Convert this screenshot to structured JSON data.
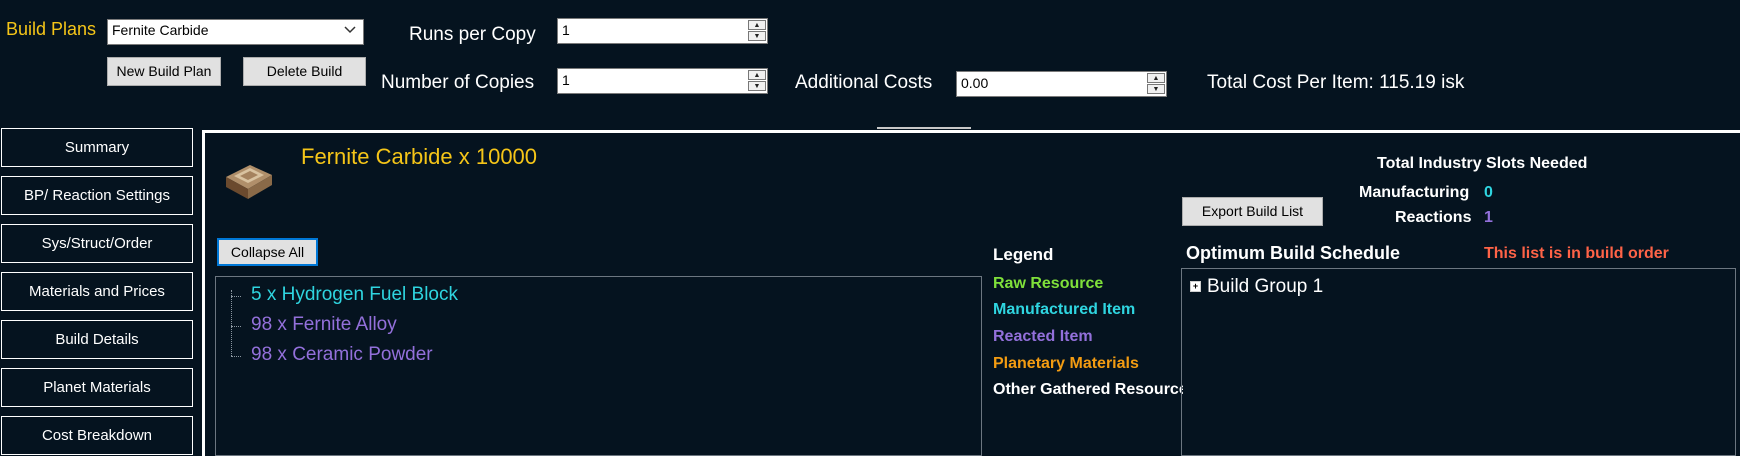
{
  "toolbar": {
    "build_plans_label": "Build Plans",
    "build_plan_value": "Fernite Carbide",
    "new_build_plan": "New Build Plan",
    "delete_build": "Delete Build",
    "runs_per_copy_label": "Runs per Copy",
    "runs_per_copy_value": "1",
    "number_of_copies_label": "Number of Copies",
    "number_of_copies_value": "1",
    "additional_costs_label": "Additional Costs",
    "additional_costs_value": "0.00",
    "total_cost": "Total Cost Per Item: 115.19 isk"
  },
  "nav": {
    "items": [
      {
        "label": "Summary"
      },
      {
        "label": "BP/ Reaction Settings"
      },
      {
        "label": "Sys/Struct/Order"
      },
      {
        "label": "Materials and Prices"
      },
      {
        "label": "Build Details"
      },
      {
        "label": "Planet Materials"
      },
      {
        "label": "Cost Breakdown"
      }
    ]
  },
  "main": {
    "product_title": "Fernite Carbide x 10000",
    "collapse_all": "Collapse All",
    "tree": [
      {
        "label": "5 x Hydrogen Fuel Block",
        "color": "#2fd5e0"
      },
      {
        "label": "98 x Fernite Alloy",
        "color": "#9370db"
      },
      {
        "label": "98 x Ceramic Powder",
        "color": "#9370db"
      }
    ],
    "legend": {
      "title": "Legend",
      "items": [
        {
          "label": "Raw Resource",
          "color": "#7fe03a"
        },
        {
          "label": "Manufactured Item",
          "color": "#2fd5e0"
        },
        {
          "label": "Reacted Item",
          "color": "#9370db"
        },
        {
          "label": "Planetary Materials",
          "color": "#f39c12"
        },
        {
          "label": "Other Gathered Resource",
          "color": "#ffffff"
        }
      ]
    },
    "slots": {
      "title": "Total Industry Slots Needed",
      "manufacturing_label": "Manufacturing",
      "manufacturing_value": "0",
      "reactions_label": "Reactions",
      "reactions_value": "1"
    },
    "export_build_list": "Export Build List",
    "schedule_title": "Optimum Build Schedule",
    "build_order_note": "This list is in build order",
    "schedule_items": [
      {
        "label": "Build Group 1"
      }
    ]
  },
  "colors": {
    "background": "#05131f",
    "title_yellow": "#f5c518",
    "cyan": "#2fd5e0",
    "purple": "#9370db",
    "note_red": "#ff6347"
  }
}
